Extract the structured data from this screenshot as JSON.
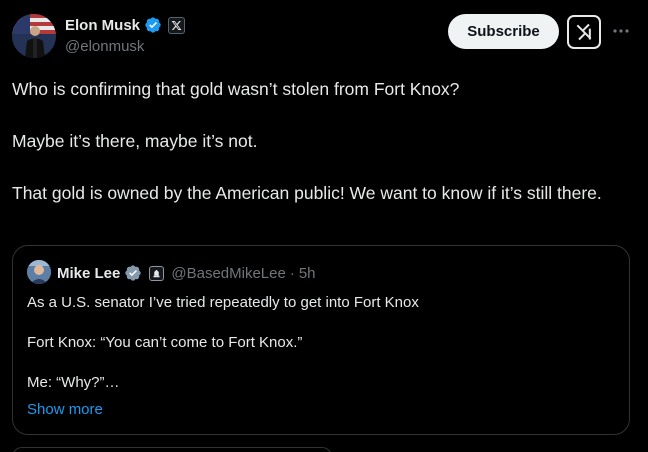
{
  "author": {
    "display_name": "Elon Musk",
    "handle": "@elonmusk",
    "verified_color": "#1d9bf0"
  },
  "actions": {
    "subscribe_label": "Subscribe",
    "grok_icon": "grok-icon",
    "more_icon": "more-horizontal-icon"
  },
  "tweet": {
    "paragraphs": [
      "Who is confirming that gold wasn’t stolen from Fort Knox?",
      "Maybe it’s there, maybe it’s not.",
      "That gold is owned by the American public! We want to know if it’s still there."
    ]
  },
  "quote": {
    "display_name": "Mike Lee",
    "handle": "@BasedMikeLee",
    "separator": "·",
    "time": "5h",
    "paragraphs": [
      "As a U.S. senator I’ve tried repeatedly to get into Fort Knox",
      "Fort Knox: “You can’t come to Fort Knox.”",
      "Me: “Why?”…"
    ],
    "show_more_label": "Show more"
  },
  "colors": {
    "background": "#000000",
    "text": "#e7e9ea",
    "secondary_text": "#71767b",
    "link": "#1d9bf0",
    "border": "#2f3336"
  }
}
